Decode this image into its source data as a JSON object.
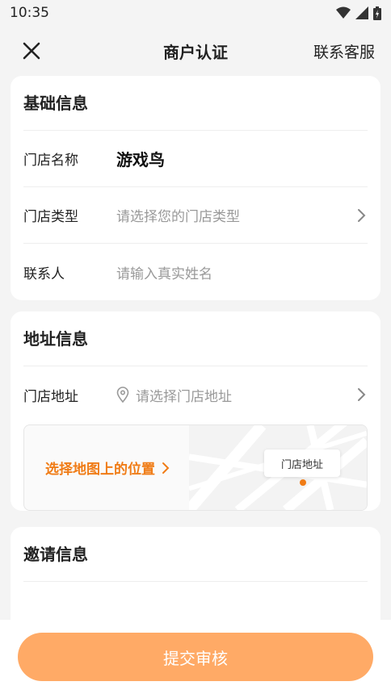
{
  "status": {
    "time": "10:35"
  },
  "header": {
    "title": "商户认证",
    "service": "联系客服"
  },
  "basic": {
    "title": "基础信息",
    "rows": [
      {
        "label": "门店名称",
        "value": "游戏鸟"
      },
      {
        "label": "门店类型",
        "placeholder": "请选择您的门店类型"
      },
      {
        "label": "联系人",
        "placeholder": "请输入真实姓名"
      }
    ]
  },
  "address": {
    "title": "地址信息",
    "label": "门店地址",
    "placeholder": "请选择门店地址",
    "map_link": "选择地图上的位置",
    "map_tag": "门店地址"
  },
  "invite": {
    "title": "邀请信息"
  },
  "submit": {
    "label": "提交审核"
  },
  "colors": {
    "accent": "#f07c16",
    "button": "#ffaa66"
  }
}
